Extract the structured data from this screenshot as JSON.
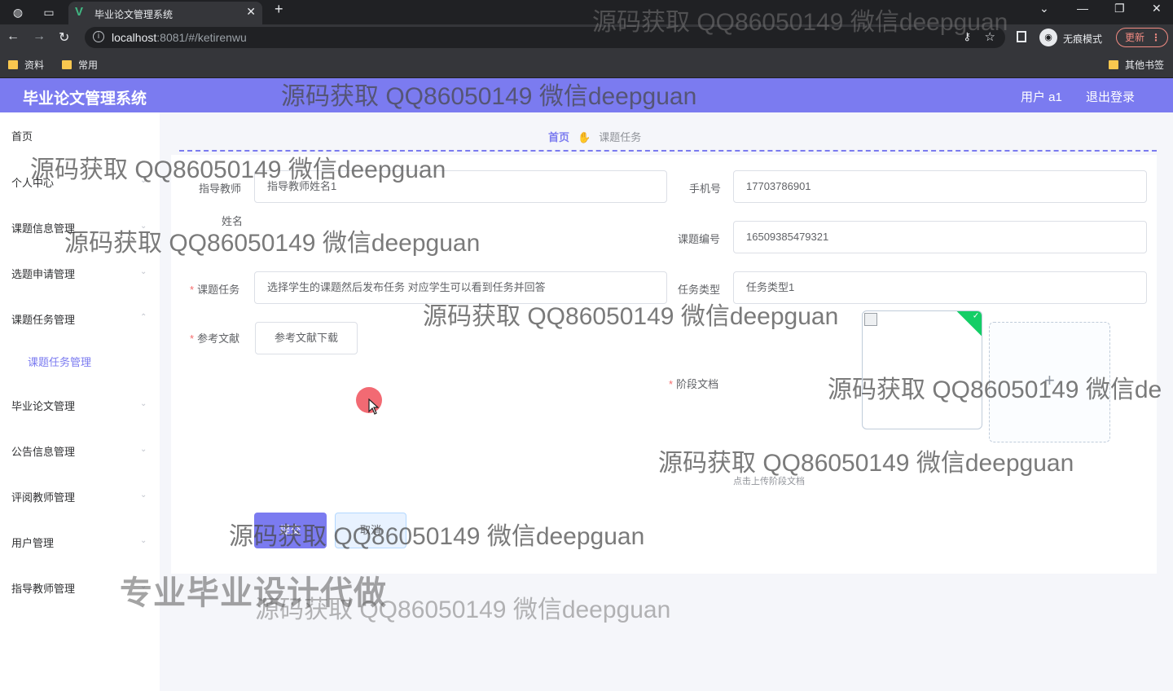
{
  "browser": {
    "tab_title": "毕业论文管理系统",
    "url_host": "localhost",
    "url_rest": ":8081/#/ketirenwu",
    "incognito_label": "无痕模式",
    "update_label": "更新",
    "bookmarks": [
      "资料",
      "常用"
    ],
    "other_bookmarks": "其他书签"
  },
  "header": {
    "title": "毕业论文管理系统",
    "user": "用户 a1",
    "logout": "退出登录"
  },
  "sidebar": {
    "items": [
      {
        "label": "首页"
      },
      {
        "label": "个人中心"
      },
      {
        "label": "课题信息管理"
      },
      {
        "label": "选题申请管理"
      },
      {
        "label": "课题任务管理"
      },
      {
        "label": "课题任务管理"
      },
      {
        "label": "毕业论文管理"
      },
      {
        "label": "公告信息管理"
      },
      {
        "label": "评阅教师管理"
      },
      {
        "label": "用户管理"
      },
      {
        "label": "指导教师管理"
      }
    ]
  },
  "breadcrumb": {
    "home": "首页",
    "current": "课题任务"
  },
  "form": {
    "teacher_label_1": "指导教师",
    "teacher_label_2": "姓名",
    "teacher_value": "指导教师姓名1",
    "phone_label": "手机号",
    "phone_value": "17703786901",
    "topic_no_label": "课题编号",
    "topic_no_value": "16509385479321",
    "task_label": "课题任务",
    "task_value": "选择学生的课题然后发布任务 对应学生可以看到任务并回答",
    "task_type_label": "任务类型",
    "task_type_value": "任务类型1",
    "ref_label": "参考文献",
    "ref_button": "参考文献下载",
    "stage_doc_label": "阶段文档",
    "upload_tip": "点击上传阶段文档",
    "submit": "提交",
    "cancel": "取消"
  },
  "watermarks": {
    "top": "源码获取 QQ86050149 微信deepguan",
    "main": "源码获取 QQ86050149 微信deepguan",
    "cut": "源码获取 QQ86050149 微信de",
    "slogan": "专业毕业设计代做"
  },
  "colors": {
    "accent": "#7b7bf0",
    "required": "#f56c6c",
    "success": "#13ce66"
  }
}
